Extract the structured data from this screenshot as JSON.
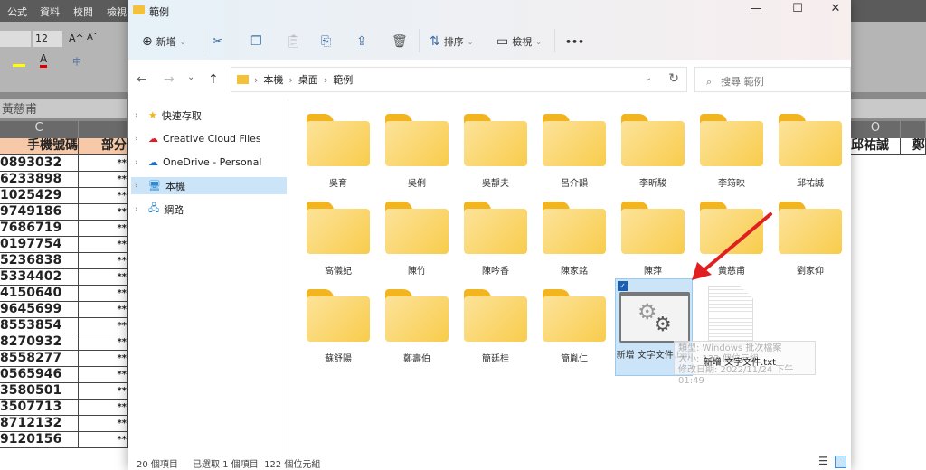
{
  "excel": {
    "tabs": [
      "公式",
      "資料",
      "校閱",
      "檢視"
    ],
    "font_size": "12",
    "formula_bar_value": "黃慈甫",
    "col_c": "C",
    "col_o": "O",
    "header_c": "手機號碼",
    "header_d": "部分",
    "header_o": "邱祐誠",
    "header_p": "鄭",
    "phones": [
      "0893032",
      "6233898",
      "1025429",
      "9749186",
      "7686719",
      "0197754",
      "5236838",
      "5334402",
      "4150640",
      "9645699",
      "8553854",
      "8270932",
      "8558277",
      "0565946",
      "3580501",
      "3507713",
      "8712132",
      "9120156"
    ],
    "masked": "**"
  },
  "explorer": {
    "title": "範例",
    "window_controls": {
      "minimize": "—",
      "maximize": "☐",
      "close": "✕"
    },
    "toolbar": {
      "new_label": "新增",
      "sort_label": "排序",
      "view_label": "檢視",
      "more_label": "•••"
    },
    "breadcrumb": [
      "本機",
      "桌面",
      "範例"
    ],
    "search_placeholder": "搜尋 範例",
    "nav_pane": [
      {
        "label": "快速存取",
        "icon": "star-icon"
      },
      {
        "label": "Creative Cloud Files",
        "icon": "creative-cloud-icon"
      },
      {
        "label": "OneDrive - Personal",
        "icon": "cloud-icon"
      },
      {
        "label": "本機",
        "icon": "computer-icon",
        "selected": true
      },
      {
        "label": "網路",
        "icon": "network-icon"
      }
    ],
    "folders": [
      "吳育",
      "吳俐",
      "吳靜夫",
      "呂介韻",
      "李昕駿",
      "李筠映",
      "邱祐誠",
      "高儀妃",
      "陳竹",
      "陳吟香",
      "陳家銘",
      "陳萍",
      "黃慈甫",
      "劉家仰",
      "蘇舒陽",
      "鄭壽伯",
      "簡廷桂",
      "簡胤仁"
    ],
    "files": [
      {
        "name": "新增 文字文件.bat",
        "icon": "batch-file-gear-icon",
        "selected": true
      },
      {
        "name": "新增 文字文件.txt",
        "icon": "text-file-icon"
      }
    ],
    "tooltip": {
      "type": "類型: Windows 批次檔案",
      "size": "大小: 122 個位元組",
      "modified": "修改日期: 2022/11/24 下午 01:49"
    },
    "status": {
      "count": "20 個項目",
      "selection": "已選取 1 個項目  122 個位元組"
    },
    "annotation_color": "#e02020"
  }
}
